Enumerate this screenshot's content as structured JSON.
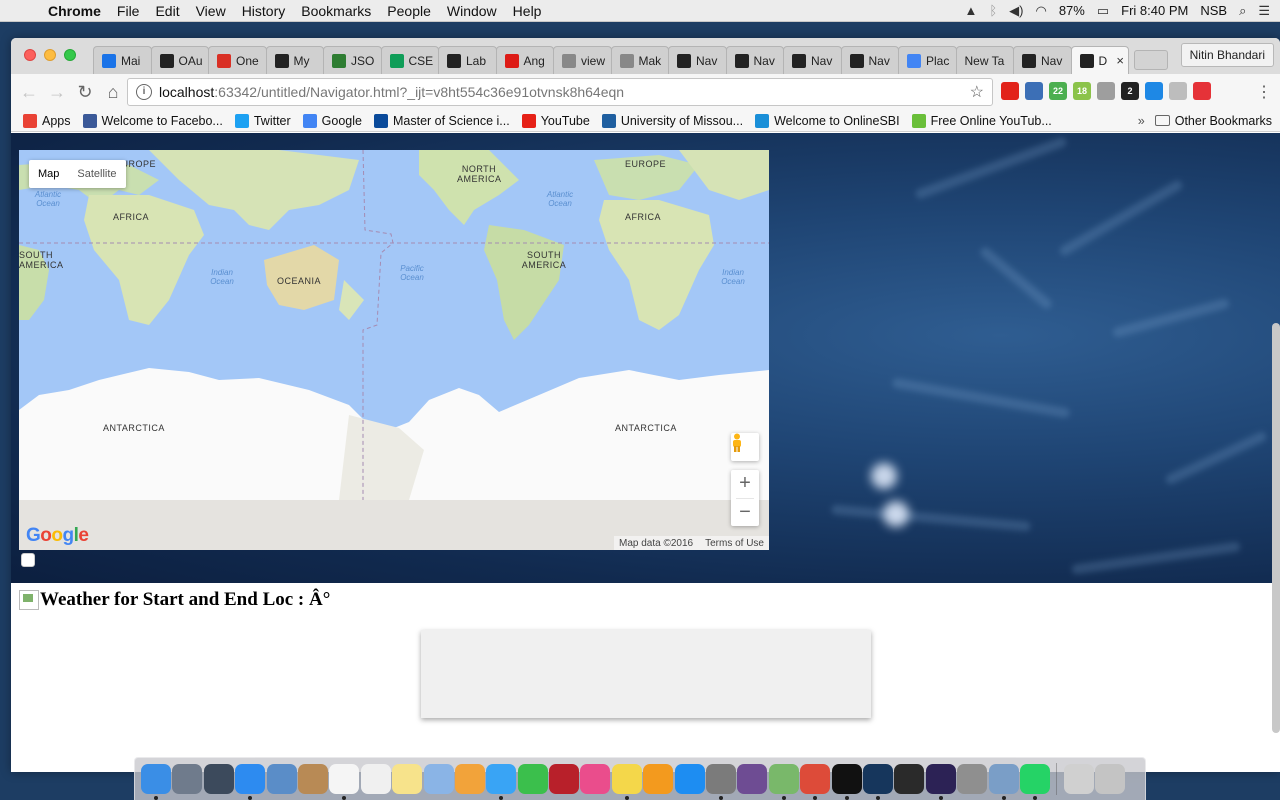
{
  "menubar": {
    "app": "Chrome",
    "items": [
      "File",
      "Edit",
      "View",
      "History",
      "Bookmarks",
      "People",
      "Window",
      "Help"
    ],
    "battery": "87%",
    "clock": "Fri 8:40 PM",
    "user": "NSB"
  },
  "browser": {
    "tabs": [
      {
        "label": "Mai",
        "icon": "gmail-icon",
        "color": "#1a73e8"
      },
      {
        "label": "OAu",
        "icon": "angular-dark-icon",
        "color": "#222222"
      },
      {
        "label": "One",
        "icon": "gmail-icon",
        "color": "#d93025"
      },
      {
        "label": "My",
        "icon": "webstorm-icon",
        "color": "#222222"
      },
      {
        "label": "JSO",
        "icon": "json-icon",
        "color": "#2e7d32"
      },
      {
        "label": "CSE",
        "icon": "sheets-icon",
        "color": "#0f9d58"
      },
      {
        "label": "Lab",
        "icon": "github-icon",
        "color": "#222222"
      },
      {
        "label": "Ang",
        "icon": "angular-icon",
        "color": "#dd1b16"
      },
      {
        "label": "view",
        "icon": "document-icon",
        "color": "#888888"
      },
      {
        "label": "Mak",
        "icon": "document-icon",
        "color": "#888888"
      },
      {
        "label": "Nav",
        "icon": "webstorm-icon",
        "color": "#222222"
      },
      {
        "label": "Nav",
        "icon": "webstorm-icon",
        "color": "#222222"
      },
      {
        "label": "Nav",
        "icon": "webstorm-icon",
        "color": "#222222"
      },
      {
        "label": "Nav",
        "icon": "webstorm-icon",
        "color": "#222222"
      },
      {
        "label": "Plac",
        "icon": "google-icon",
        "color": "#4285f4"
      },
      {
        "label": "New Ta",
        "icon": "",
        "color": "#d0d0d0"
      },
      {
        "label": "Nav",
        "icon": "webstorm-icon",
        "color": "#222222"
      },
      {
        "label": "D",
        "icon": "webstorm-icon",
        "color": "#222222",
        "active": true
      }
    ],
    "profile": "Nitin Bhandari",
    "url_host": "localhost",
    "url_path": ":63342/untitled/Navigator.html?_ijt=v8ht554c36e91otvnsk8h64eqn",
    "extensions": [
      {
        "name": "opera-icon",
        "color": "#e2231a",
        "badge": ""
      },
      {
        "name": "zotero-icon",
        "color": "#3c6fb6",
        "badge": ""
      },
      {
        "name": "ext-green-icon",
        "color": "#4caf50",
        "badge": "22"
      },
      {
        "name": "calendar-icon",
        "color": "#8bc34a",
        "badge": "18"
      },
      {
        "name": "cloud-icon",
        "color": "#9e9e9e",
        "badge": ""
      },
      {
        "name": "amazon-icon",
        "color": "#222222",
        "badge": "2"
      },
      {
        "name": "search-ext-icon",
        "color": "#1e88e5",
        "badge": ""
      },
      {
        "name": "ext-grey-icon",
        "color": "#bdbdbd",
        "badge": ""
      },
      {
        "name": "ebay-icon",
        "color": "#e53238",
        "badge": ""
      }
    ]
  },
  "bookmarks": [
    {
      "label": "Apps",
      "icon": "apps-icon",
      "color": "#e94235"
    },
    {
      "label": "Welcome to Facebo...",
      "icon": "facebook-icon",
      "color": "#3b5998"
    },
    {
      "label": "Twitter",
      "icon": "twitter-icon",
      "color": "#1da1f2"
    },
    {
      "label": "Google",
      "icon": "google-icon",
      "color": "#4285f4"
    },
    {
      "label": "Master of Science i...",
      "icon": "umkc-icon",
      "color": "#0a4a9a"
    },
    {
      "label": "YouTube",
      "icon": "youtube-icon",
      "color": "#e62117"
    },
    {
      "label": "University of Missou...",
      "icon": "umkc-icon",
      "color": "#1f5fa0"
    },
    {
      "label": "Welcome to OnlineSBI",
      "icon": "sbi-icon",
      "color": "#1a8fd8"
    },
    {
      "label": "Free Online YouTub...",
      "icon": "download-icon",
      "color": "#6abf3a"
    }
  ],
  "bookmarks_other": "Other Bookmarks",
  "map": {
    "type_map": "Map",
    "type_satellite": "Satellite",
    "zoom_in": "+",
    "zoom_out": "−",
    "google": "Google",
    "data": "Map data ©2016",
    "terms": "Terms of Use",
    "labels": {
      "europe_l": "EUROPE",
      "africa_l": "AFRICA",
      "south_america_l": "SOUTH AMERICA",
      "oceania": "OCEANIA",
      "north_america": "NORTH AMERICA",
      "south_america_r": "SOUTH AMERICA",
      "europe_r": "EUROPE",
      "africa_r": "AFRICA",
      "antarctica_l": "ANTARCTICA",
      "antarctica_r": "ANTARCTICA",
      "atlantic_l": "Atlantic Ocean",
      "indian_l": "Indian Ocean",
      "pacific": "Pacific Ocean",
      "atlantic_r": "Atlantic Ocean",
      "indian_r": "Indian Ocean"
    }
  },
  "weather_heading": "Weather for Start and End Loc : Â°",
  "dock": [
    {
      "name": "finder-icon",
      "color": "#3a8ee6",
      "running": true
    },
    {
      "name": "launchpad-icon",
      "color": "#6f7b8c",
      "running": false
    },
    {
      "name": "mission-control-icon",
      "color": "#3c4a5c",
      "running": false
    },
    {
      "name": "safari-icon",
      "color": "#2d8bf0",
      "running": true
    },
    {
      "name": "preview-icon",
      "color": "#5a8dc8",
      "running": false
    },
    {
      "name": "contacts-icon",
      "color": "#b88a55",
      "running": false
    },
    {
      "name": "calendar-icon",
      "color": "#f5f5f5",
      "running": true
    },
    {
      "name": "reminders-icon",
      "color": "#f0f0f0",
      "running": false
    },
    {
      "name": "notes-icon",
      "color": "#f7e38b",
      "running": false
    },
    {
      "name": "preview-alt-icon",
      "color": "#8ab4e6",
      "running": false
    },
    {
      "name": "photos-icon",
      "color": "#f2a33a",
      "running": false
    },
    {
      "name": "messages-icon",
      "color": "#39a4f5",
      "running": true
    },
    {
      "name": "facetime-icon",
      "color": "#3bbf4c",
      "running": false
    },
    {
      "name": "photo-booth-icon",
      "color": "#b8202a",
      "running": false
    },
    {
      "name": "itunes-icon",
      "color": "#ea4d8c",
      "running": false
    },
    {
      "name": "stickies-icon",
      "color": "#f4d74a",
      "running": true
    },
    {
      "name": "ibooks-icon",
      "color": "#f39a1e",
      "running": false
    },
    {
      "name": "app-store-icon",
      "color": "#1d8df2",
      "running": false
    },
    {
      "name": "system-prefs-icon",
      "color": "#7b7b7b",
      "running": true
    },
    {
      "name": "github-icon",
      "color": "#6e4c93",
      "running": false
    },
    {
      "name": "android-studio-icon",
      "color": "#79b86a",
      "running": true
    },
    {
      "name": "chrome-icon",
      "color": "#dd4b39",
      "running": true
    },
    {
      "name": "intellij-icon",
      "color": "#111111",
      "running": true
    },
    {
      "name": "webstorm-icon",
      "color": "#16365c",
      "running": true
    },
    {
      "name": "terminal-icon",
      "color": "#2a2a2a",
      "running": false
    },
    {
      "name": "eclipse-icon",
      "color": "#2c2255",
      "running": true
    },
    {
      "name": "utility-icon",
      "color": "#8f8f8f",
      "running": false
    },
    {
      "name": "image-capture-icon",
      "color": "#7a9ec7",
      "running": true
    },
    {
      "name": "whatsapp-icon",
      "color": "#25d366",
      "running": true
    },
    {
      "name": "documents-icon",
      "color": "#d0d0d0",
      "running": false
    },
    {
      "name": "trash-icon",
      "color": "#c4c4c4",
      "running": false
    }
  ]
}
